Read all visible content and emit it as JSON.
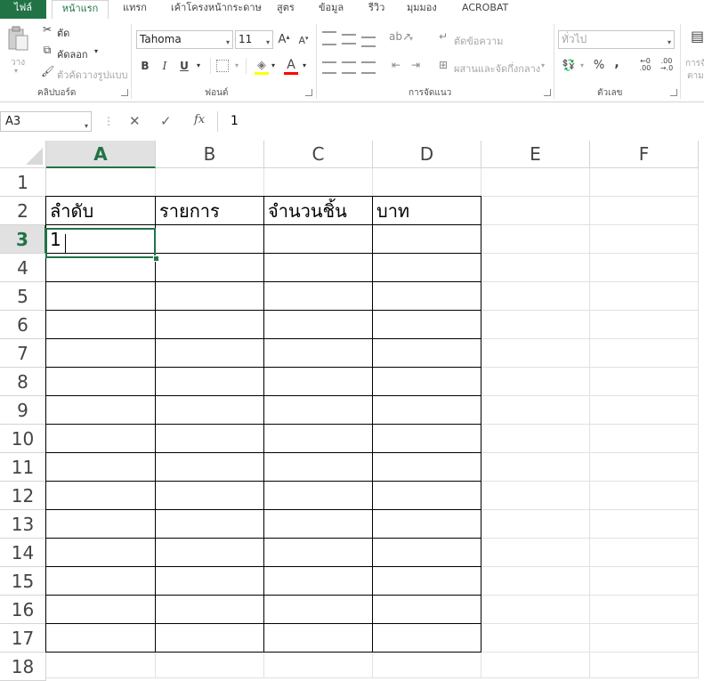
{
  "tabs": [
    "ไฟล์",
    "หน้าแรก",
    "แทรก",
    "เค้าโครงหน้ากระดาษ",
    "สูตร",
    "ข้อมูล",
    "รีวิว",
    "มุมมอง",
    "ACROBAT"
  ],
  "clipboard": {
    "paste": "วาง",
    "cut": "ตัด",
    "copy": "คัดลอก",
    "format_painter": "ตัวคัดวางรูปแบบ",
    "group_label": "คลิปบอร์ด"
  },
  "font": {
    "name": "Tahoma",
    "size": "11",
    "bold": "B",
    "italic": "I",
    "underline": "U",
    "font_color_letter": "A",
    "group_label": "ฟอนต์",
    "font_color": "#ff0000"
  },
  "alignment": {
    "wrap_text": "ตัดข้อความ",
    "merge_center": "ผสานและจัดกึ่งกลาง",
    "group_label": "การจัดแนว"
  },
  "number": {
    "format": "ทั่วไป",
    "percent": "%",
    "comma": ",",
    "group_label": "ตัวเลข"
  },
  "styles_partial": {
    "line1": "การจั",
    "line2": "ตาม"
  },
  "formula_bar": {
    "name_box": "A3",
    "cancel": "✕",
    "enter": "✓",
    "fx": "fx",
    "value": "1"
  },
  "columns": [
    "A",
    "B",
    "C",
    "D",
    "E",
    "F"
  ],
  "rows": [
    "1",
    "2",
    "3",
    "4",
    "5",
    "6",
    "7",
    "8",
    "9",
    "10",
    "11",
    "12",
    "13",
    "14",
    "15",
    "16",
    "17",
    "18"
  ],
  "cells": {
    "A2": "ลำดับ",
    "B2": "รายการ",
    "C2": "จำนวนชิ้น",
    "D2": "บาท",
    "A3": "1"
  },
  "colors": {
    "accent": "#217346"
  }
}
